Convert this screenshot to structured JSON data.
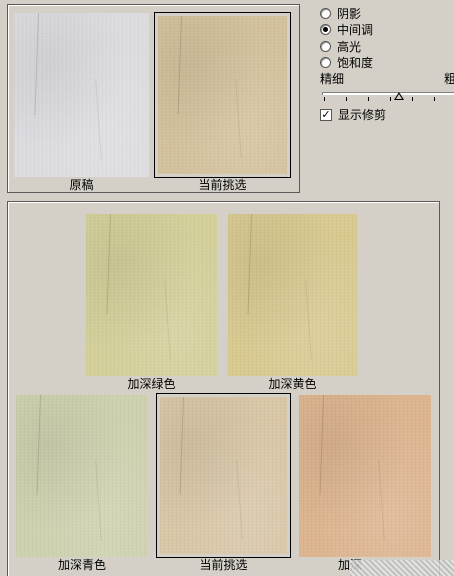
{
  "top_panel": {
    "original_label": "原稿",
    "current_label": "当前挑选"
  },
  "range": {
    "options": [
      {
        "label": "阴影",
        "checked": false
      },
      {
        "label": "中间调",
        "checked": true
      },
      {
        "label": "高光",
        "checked": false
      },
      {
        "label": "饱和度",
        "checked": false
      }
    ]
  },
  "fineness": {
    "fine_label": "精细",
    "coarse_label": "粗",
    "value_fraction": 0.58
  },
  "show_clipping": {
    "label": "显示修剪",
    "checked": true,
    "check_glyph": "✓"
  },
  "variations": {
    "more_green_label": "加深绿色",
    "more_yellow_label": "加深黄色",
    "more_cyan_label": "加深青色",
    "current_label": "当前挑选",
    "more_red_label": "加深"
  },
  "colors": {
    "original": "#dcdbe0",
    "current": "#d3c19c",
    "more_green": "#d2cf99",
    "more_yellow": "#d8c98f",
    "more_cyan": "#cdd1ad",
    "current_lower": "#d8c6a6",
    "more_red": "#dcb48f"
  }
}
